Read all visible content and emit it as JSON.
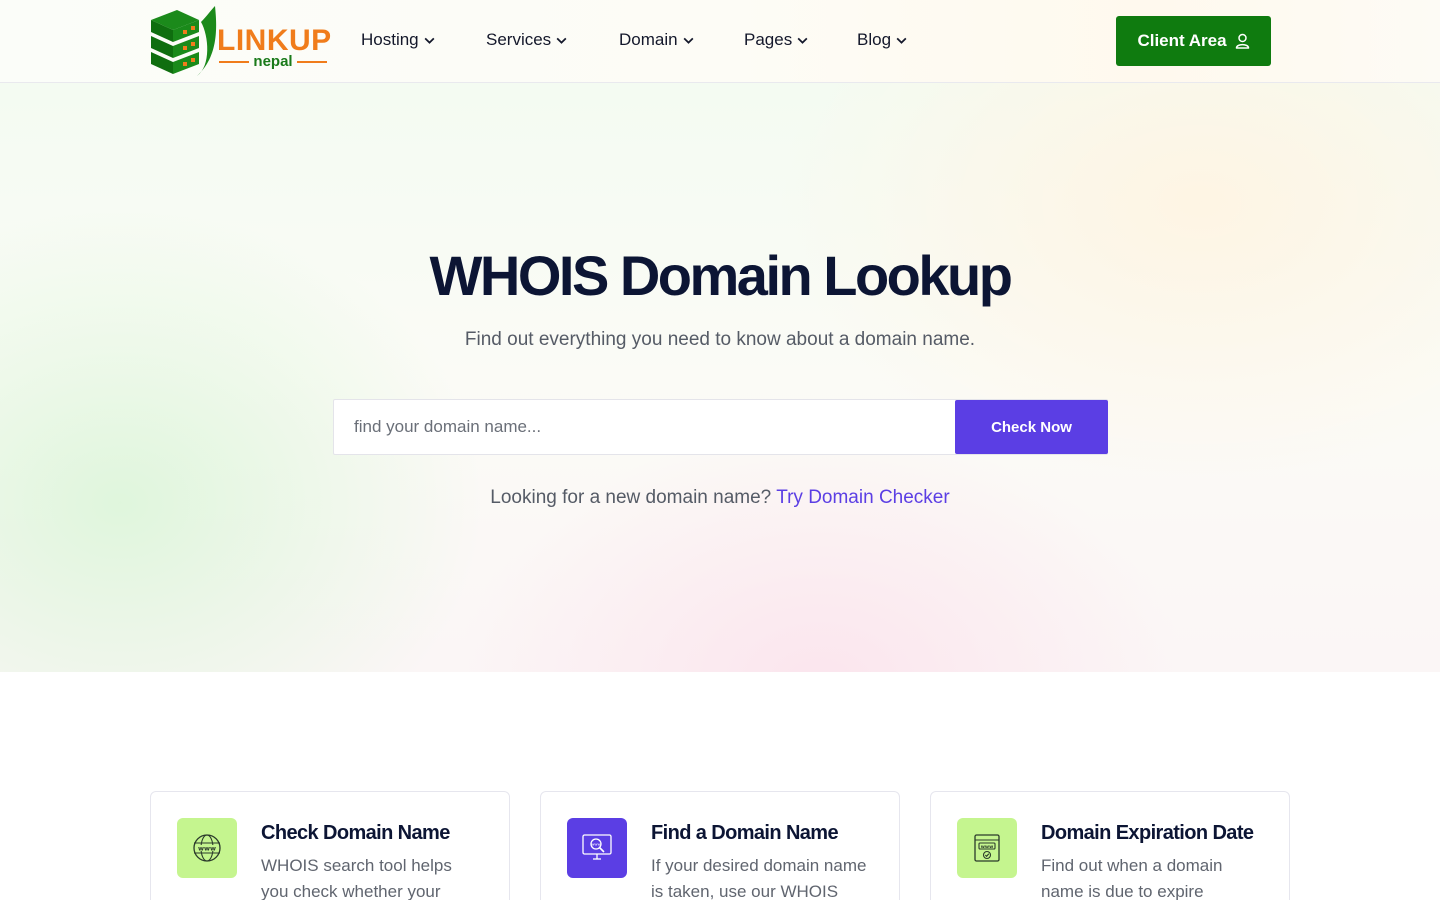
{
  "brand": {
    "logo_word": "LINKUP",
    "logo_sub": "nepal",
    "primary_green": "#0f7b0f",
    "logo_orange": "#f07c1b",
    "accent_purple": "#5b3ee4"
  },
  "nav": {
    "items": [
      {
        "label": "Hosting",
        "icon": "chevron-down-icon"
      },
      {
        "label": "Services",
        "icon": "chevron-down-icon"
      },
      {
        "label": "Domain",
        "icon": "chevron-down-icon"
      },
      {
        "label": "Pages",
        "icon": "chevron-down-icon"
      },
      {
        "label": "Blog",
        "icon": "chevron-down-icon"
      }
    ],
    "client_area": {
      "label": "Client Area",
      "icon": "user-icon"
    }
  },
  "hero": {
    "title": "WHOIS Domain Lookup",
    "subtitle": "Find out everything you need to know about a domain name.",
    "search": {
      "placeholder": "find your domain name...",
      "value": "",
      "button_label": "Check Now"
    },
    "note_text": "Looking for a new domain name?",
    "note_link": "Try Domain Checker"
  },
  "features": [
    {
      "title": "Check Domain Name",
      "description": "WHOIS search tool helps you check whether your",
      "icon": "www-globe-icon",
      "icon_bg": "#c5f58f"
    },
    {
      "title": "Find a Domain Name",
      "description": "If your desired domain name is taken, use our WHOIS",
      "icon": "monitor-search-icon",
      "icon_bg": "#5b3ee4"
    },
    {
      "title": "Domain Expiration Date",
      "description": "Find out when a domain name is due to expire",
      "icon": "browser-check-icon",
      "icon_bg": "#c5f58f"
    }
  ]
}
